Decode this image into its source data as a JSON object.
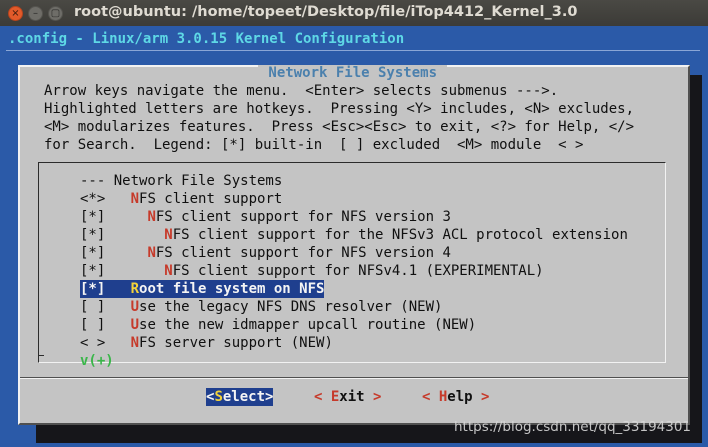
{
  "window": {
    "title": "root@ubuntu: /home/topeet/Desktop/file/iTop4412_Kernel_3.0",
    "close_glyph": "×",
    "min_glyph": "–",
    "max_glyph": "▢"
  },
  "terminal": {
    "config_title": ".config - Linux/arm 3.0.15 Kernel Configuration"
  },
  "dialog": {
    "title": " Network File Systems ",
    "help_lines": [
      "Arrow keys navigate the menu.  <Enter> selects submenus --->.",
      "Highlighted letters are hotkeys.  Pressing <Y> includes, <N> excludes,",
      "<M> modularizes features.  Press <Esc><Esc> to exit, <?> for Help, </>",
      "for Search.  Legend: [*] built-in  [ ] excluded  <M> module  < >"
    ],
    "items": [
      {
        "prefix": "--- ",
        "hot": "",
        "rest": "Network File Systems"
      },
      {
        "prefix": "<*>   ",
        "hot": "N",
        "rest": "FS client support"
      },
      {
        "prefix": "[*]     ",
        "hot": "N",
        "rest": "FS client support for NFS version 3"
      },
      {
        "prefix": "[*]       ",
        "hot": "N",
        "rest": "FS client support for the NFSv3 ACL protocol extension"
      },
      {
        "prefix": "[*]     ",
        "hot": "N",
        "rest": "FS client support for NFS version 4"
      },
      {
        "prefix": "[*]       ",
        "hot": "N",
        "rest": "FS client support for NFSv4.1 (EXPERIMENTAL)"
      },
      {
        "prefix": "[*]   ",
        "hot": "R",
        "rest": "oot file system on NFS"
      },
      {
        "prefix": "[ ]   ",
        "hot": "U",
        "rest": "se the legacy NFS DNS resolver (NEW)"
      },
      {
        "prefix": "[ ]   ",
        "hot": "U",
        "rest": "se the new idmapper upcall routine (NEW)"
      },
      {
        "prefix": "< >   ",
        "hot": "N",
        "rest": "FS server support (NEW)"
      }
    ],
    "selected_index": 6,
    "more_indicator": "v(+)",
    "buttons": {
      "select": {
        "open": "<",
        "hot": "S",
        "rest": "elect",
        "close": ">"
      },
      "exit": {
        "open": "< ",
        "hot": "E",
        "rest": "xit",
        "close": " >"
      },
      "help": {
        "open": "< ",
        "hot": "H",
        "rest": "elp",
        "close": " >"
      }
    }
  },
  "watermark": "https://blog.csdn.net/qq_33194301"
}
